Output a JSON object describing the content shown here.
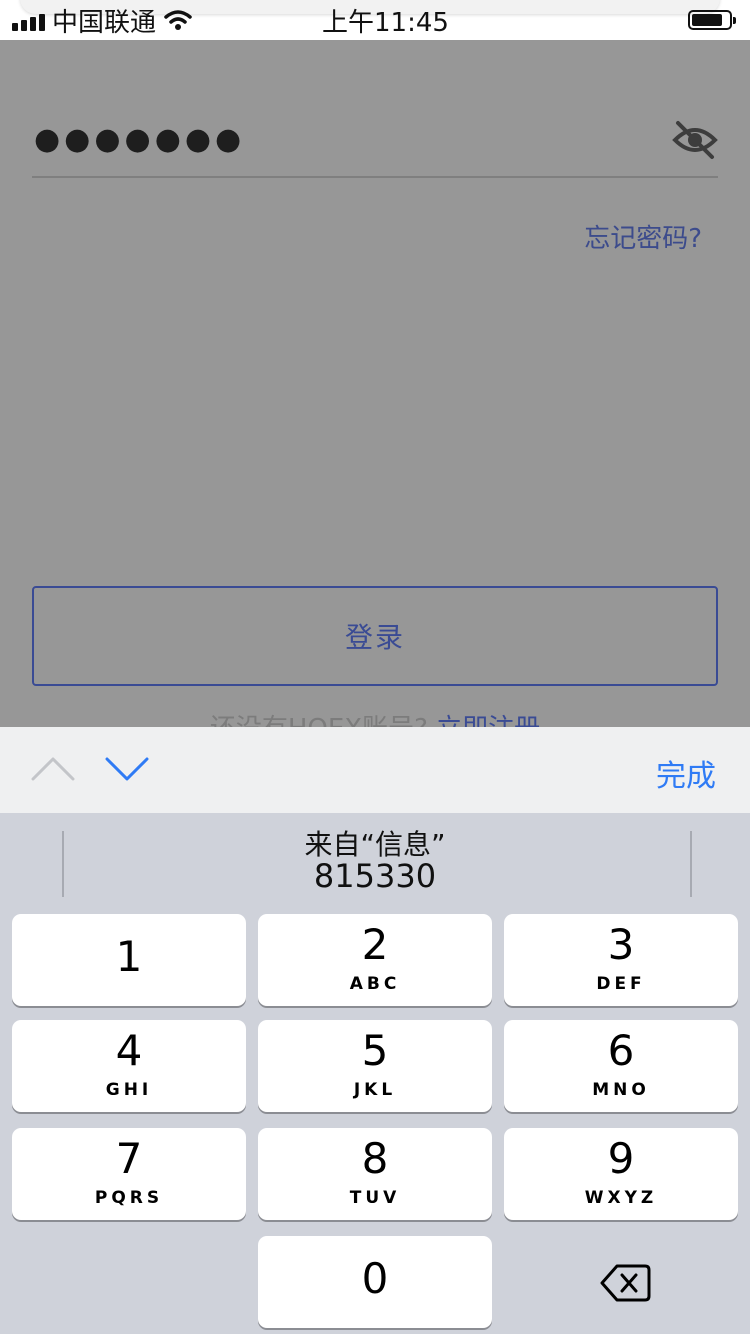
{
  "status_bar": {
    "carrier": "中国联通",
    "time": "上午11:45"
  },
  "login_form": {
    "password_masked": "●●●●●●●",
    "forgot_password": "忘记密码?",
    "login_button": "登录",
    "register_prompt": "还没有HOEX账号?",
    "register_link": "立即注册"
  },
  "keyboard_accessory": {
    "done_label": "完成"
  },
  "keyboard": {
    "suggestion_label": "来自“信息”",
    "suggestion_code": "815330",
    "keys": [
      {
        "num": "1",
        "letters": ""
      },
      {
        "num": "2",
        "letters": "ABC"
      },
      {
        "num": "3",
        "letters": "DEF"
      },
      {
        "num": "4",
        "letters": "GHI"
      },
      {
        "num": "5",
        "letters": "JKL"
      },
      {
        "num": "6",
        "letters": "MNO"
      },
      {
        "num": "7",
        "letters": "PQRS"
      },
      {
        "num": "8",
        "letters": "TUV"
      },
      {
        "num": "9",
        "letters": "WXYZ"
      },
      {
        "num": "0",
        "letters": ""
      }
    ]
  },
  "colors": {
    "accent_blue": "#2f7bf5",
    "brand_navy": "#3a4b94",
    "overlay_gray": "#979797",
    "keyboard_bg": "#cfd2da"
  }
}
